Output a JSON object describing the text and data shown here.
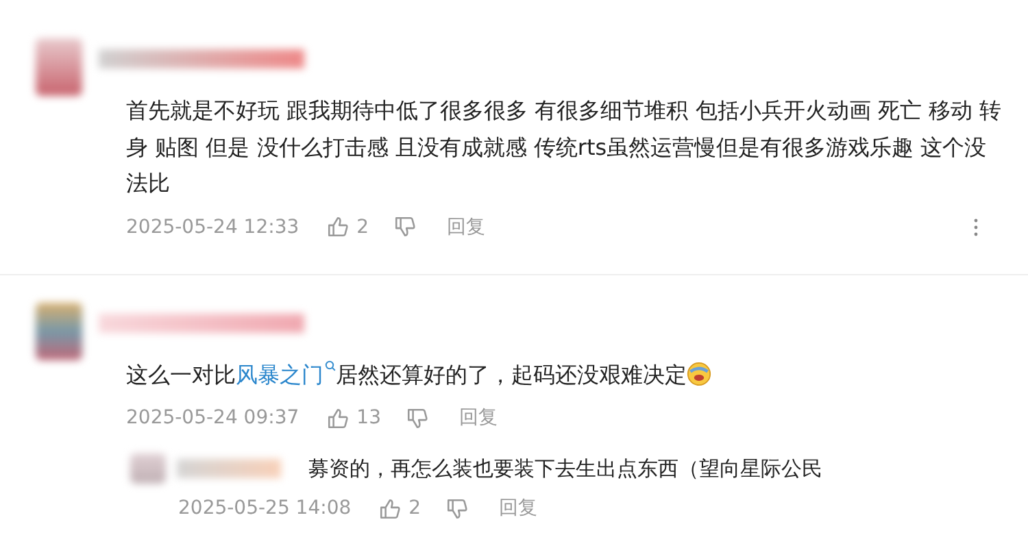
{
  "comments": [
    {
      "kind": "top",
      "parts": [
        {
          "kind": "text",
          "text": "首先就是不好玩 跟我期待中低了很多很多 有很多细节堆积 包括小兵开火动画 死亡 移动 转身 贴图 但是 没什么打击感 且没有成就感 传统rts虽然运营慢但是有很多游戏乐趣 这个没法比"
        }
      ],
      "time": "2025-05-24 12:33",
      "likes": "2",
      "reply": "回复",
      "more": true
    },
    {
      "kind": "top",
      "parts": [
        {
          "kind": "text",
          "text": "这么一对比"
        },
        {
          "kind": "link",
          "text": "风暴之门"
        },
        {
          "kind": "text",
          "text": "居然还算好的了，起码还没艰难决定"
        },
        {
          "kind": "emoji"
        }
      ],
      "time": "2025-05-24 09:37",
      "likes": "13",
      "reply": "回复",
      "more": false
    },
    {
      "kind": "reply",
      "parts": [
        {
          "kind": "text",
          "text": "募资的，再怎么装也要装下去生出点东西（望向星际公民"
        }
      ],
      "time": "2025-05-25 14:08",
      "likes": "2",
      "reply": "回复",
      "more": false
    }
  ]
}
